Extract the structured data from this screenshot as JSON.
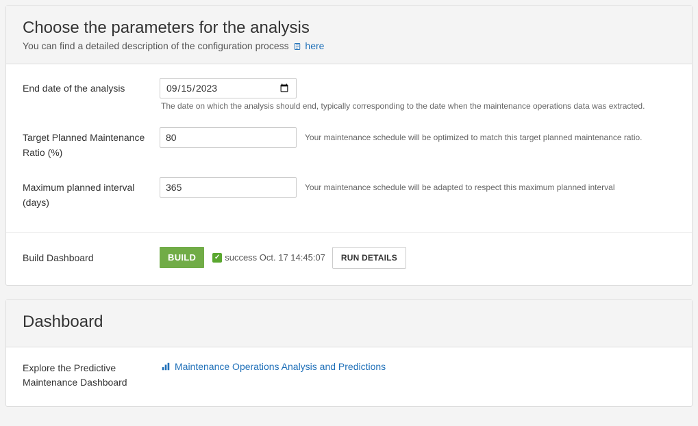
{
  "panel1": {
    "title": "Choose the parameters for the analysis",
    "subtitle_prefix": "You can find a detailed description of the configuration process ",
    "subtitle_link": "here",
    "fields": {
      "end_date": {
        "label": "End date of the analysis",
        "value": "2023-09-15",
        "help": "The date on which the analysis should end, typically corresponding to the date when the maintenance operations data was extracted."
      },
      "target_ratio": {
        "label": "Target Planned Maintenance Ratio (%)",
        "value": "80",
        "help": "Your maintenance schedule will be optimized to match this target planned maintenance ratio."
      },
      "max_interval": {
        "label": "Maximum planned interval (days)",
        "value": "365",
        "help": "Your maintenance schedule will be adapted to respect this maximum planned interval"
      }
    },
    "build": {
      "label": "Build Dashboard",
      "button": "BUILD",
      "status": "success Oct. 17 14:45:07",
      "run_details": "RUN DETAILS"
    }
  },
  "panel2": {
    "title": "Dashboard",
    "explore_label": "Explore the Predictive Maintenance Dashboard",
    "link": "Maintenance Operations Analysis and Predictions"
  }
}
